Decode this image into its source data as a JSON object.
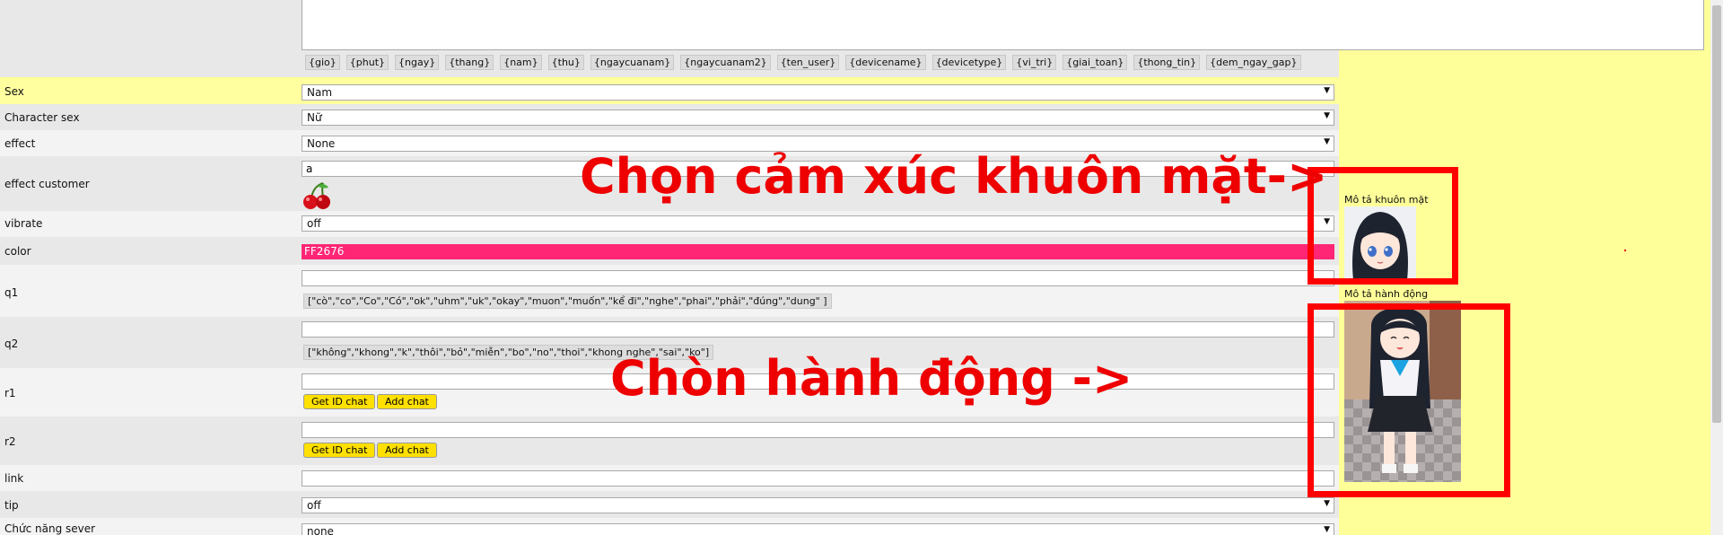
{
  "tokens": [
    "{gio}",
    "{phut}",
    "{ngay}",
    "{thang}",
    "{nam}",
    "{thu}",
    "{ngaycuanam}",
    "{ngaycuanam2}",
    "{ten_user}",
    "{devicename}",
    "{devicetype}",
    "{vi_tri}",
    "{giai_toan}",
    "{thong_tin}",
    "{dem_ngay_gap}"
  ],
  "rows": {
    "sex": {
      "label": "Sex",
      "value": "Nam"
    },
    "character_sex": {
      "label": "Character sex",
      "value": "Nữ"
    },
    "effect": {
      "label": "effect",
      "value": "None"
    },
    "effect_customer": {
      "label": "effect customer",
      "value": "a"
    },
    "vibrate": {
      "label": "vibrate",
      "value": "off"
    },
    "color": {
      "label": "color",
      "value": "FF2676",
      "color_hex": "#ff2676"
    },
    "q1": {
      "label": "q1",
      "value": "",
      "hint": "[\"cò\",\"co\",\"Co\",\"Có\",\"ok\",\"uhm\",\"uk\",\"okay\",\"muon\",\"muốn\",\"kể đi\",\"nghe\",\"phai\",\"phải\",\"đúng\",\"dung\" ]"
    },
    "q2": {
      "label": "q2",
      "value": "",
      "hint": "[\"không\",\"khong\",\"k\",\"thôi\",\"bỏ\",\"miễn\",\"bo\",\"no\",\"thoi\",\"khong nghe\",\"sai\",\"ko\"]"
    },
    "r1": {
      "label": "r1",
      "value": "",
      "btn_get": "Get ID chat",
      "btn_add": "Add chat"
    },
    "r2": {
      "label": "r2",
      "value": "",
      "btn_get": "Get ID chat",
      "btn_add": "Add chat"
    },
    "link": {
      "label": "link",
      "value": ""
    },
    "tip": {
      "label": "tip",
      "value": "off"
    },
    "server": {
      "label": "Chức năng sever",
      "value": "none"
    }
  },
  "side": {
    "face_label": "Mô tả khuôn mặt",
    "action_label": "Mô tả hành động"
  },
  "annotations": {
    "face": "Chọn cảm xúc khuôn mặt->",
    "action": "Chòn hành động ->"
  },
  "colors": {
    "accent_red": "#ee0000",
    "panel_yellow": "#ffff99",
    "button_yellow": "#ffe000"
  }
}
